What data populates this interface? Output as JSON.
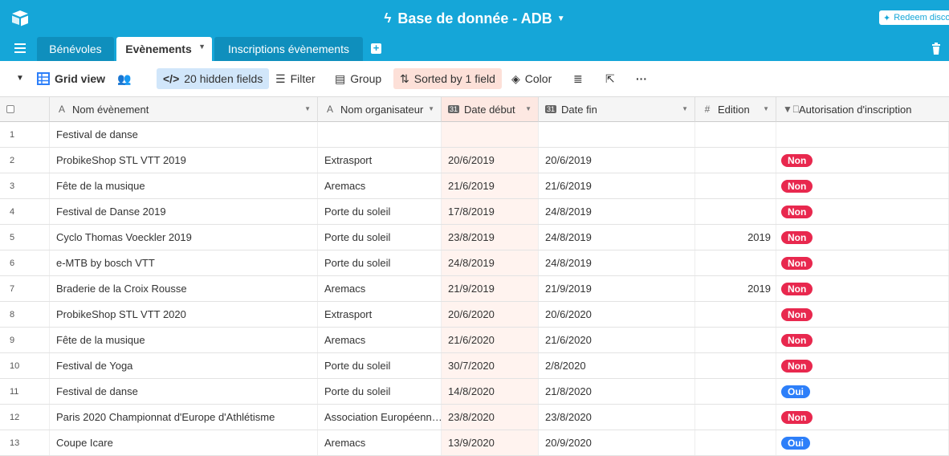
{
  "app": {
    "title": "Base de donnée - ADB",
    "redeem_label": "Redeem disco"
  },
  "tabs": [
    {
      "label": "Bénévoles",
      "active": false
    },
    {
      "label": "Evènements",
      "active": true
    },
    {
      "label": "Inscriptions évènements",
      "active": false
    }
  ],
  "viewbar": {
    "view_name": "Grid view",
    "hidden_fields": "20 hidden fields",
    "filter": "Filter",
    "group": "Group",
    "sorted": "Sorted by 1 field",
    "color": "Color"
  },
  "columns": [
    {
      "label": "Nom évènement",
      "type_icon": "A"
    },
    {
      "label": "Nom organisateur",
      "type_icon": "A"
    },
    {
      "label": "Date début",
      "type_icon": "31"
    },
    {
      "label": "Date fin",
      "type_icon": "31"
    },
    {
      "label": "Edition",
      "type_icon": "#"
    },
    {
      "label": "Autorisation d'inscription",
      "type_icon": "select"
    }
  ],
  "rows": [
    {
      "n": "1",
      "nom": "Festival de danse",
      "org": "",
      "debut": "",
      "fin": "",
      "edition": "",
      "auth": ""
    },
    {
      "n": "2",
      "nom": "ProbikeShop STL VTT 2019",
      "org": "Extrasport",
      "debut": "20/6/2019",
      "fin": "20/6/2019",
      "edition": "",
      "auth": "Non"
    },
    {
      "n": "3",
      "nom": "Fête de la musique",
      "org": "Aremacs",
      "debut": "21/6/2019",
      "fin": "21/6/2019",
      "edition": "",
      "auth": "Non"
    },
    {
      "n": "4",
      "nom": "Festival de Danse 2019",
      "org": "Porte du soleil",
      "debut": "17/8/2019",
      "fin": "24/8/2019",
      "edition": "",
      "auth": "Non"
    },
    {
      "n": "5",
      "nom": "Cyclo Thomas Voeckler 2019",
      "org": "Porte du soleil",
      "debut": "23/8/2019",
      "fin": "24/8/2019",
      "edition": "2019",
      "auth": "Non"
    },
    {
      "n": "6",
      "nom": "e-MTB by bosch VTT",
      "org": "Porte du soleil",
      "debut": "24/8/2019",
      "fin": "24/8/2019",
      "edition": "",
      "auth": "Non"
    },
    {
      "n": "7",
      "nom": "Braderie de la Croix Rousse",
      "org": "Aremacs",
      "debut": "21/9/2019",
      "fin": "21/9/2019",
      "edition": "2019",
      "auth": "Non"
    },
    {
      "n": "8",
      "nom": "ProbikeShop STL VTT 2020",
      "org": "Extrasport",
      "debut": "20/6/2020",
      "fin": "20/6/2020",
      "edition": "",
      "auth": "Non"
    },
    {
      "n": "9",
      "nom": "Fête de la musique",
      "org": "Aremacs",
      "debut": "21/6/2020",
      "fin": "21/6/2020",
      "edition": "",
      "auth": "Non"
    },
    {
      "n": "10",
      "nom": "Festival de Yoga",
      "org": "Porte du soleil",
      "debut": "30/7/2020",
      "fin": "2/8/2020",
      "edition": "",
      "auth": "Non"
    },
    {
      "n": "11",
      "nom": "Festival de danse",
      "org": "Porte du soleil",
      "debut": "14/8/2020",
      "fin": "21/8/2020",
      "edition": "",
      "auth": "Oui"
    },
    {
      "n": "12",
      "nom": "Paris 2020 Championnat d'Europe d'Athlétisme",
      "org": "Association Européenn…",
      "debut": "23/8/2020",
      "fin": "23/8/2020",
      "edition": "",
      "auth": "Non"
    },
    {
      "n": "13",
      "nom": "Coupe Icare",
      "org": "Aremacs",
      "debut": "13/9/2020",
      "fin": "20/9/2020",
      "edition": "",
      "auth": "Oui"
    }
  ],
  "colors": {
    "topbar": "#15a6d8",
    "pill_non": "#e8284e",
    "pill_oui": "#2d7ff9",
    "hidden_fields_bg": "#d1e6fa",
    "sorted_bg": "#fde0d8"
  }
}
